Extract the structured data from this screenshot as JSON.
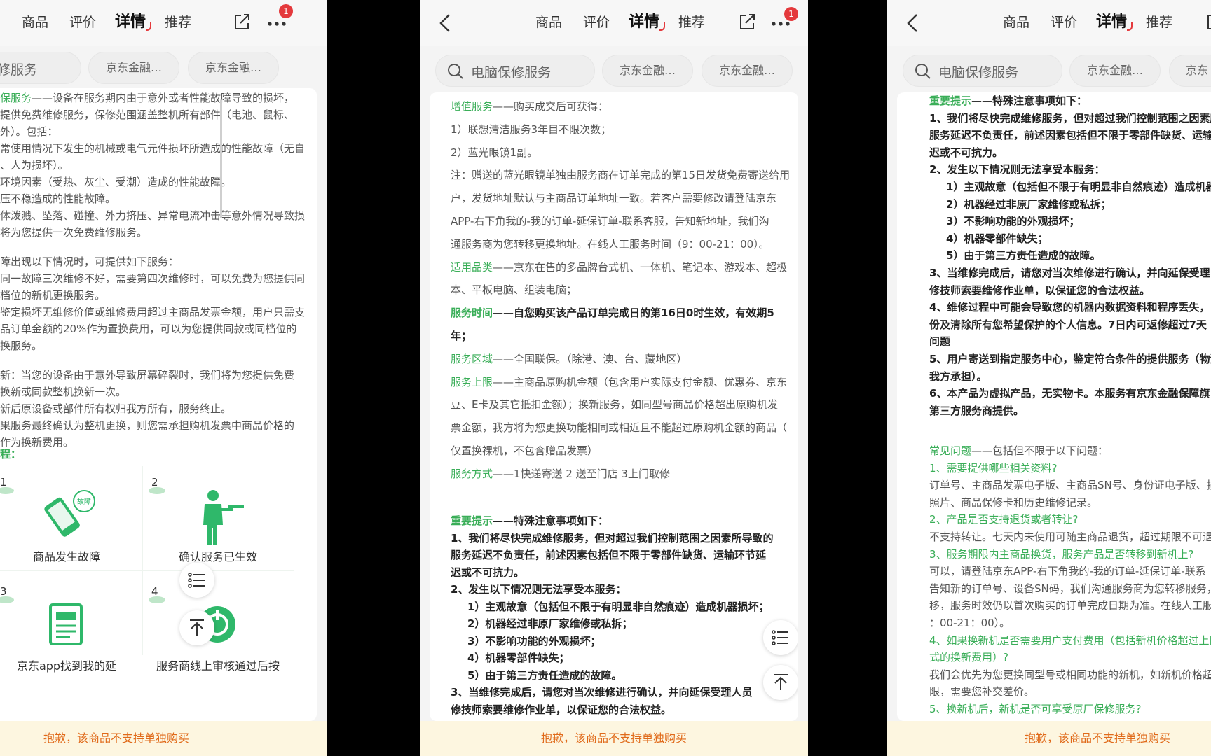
{
  "header": {
    "tabs": [
      "商品",
      "评价",
      "详情",
      "推荐"
    ],
    "active_tab": "详情",
    "badge_count": "1"
  },
  "chips": {
    "search_label": "电脑保修服务",
    "chip1": "京东金融…",
    "chip2": "京东金融…",
    "chip3": "京东"
  },
  "bottom_notice": "抱歉，该商品不支持单独购买",
  "panel1": {
    "lines": [
      {
        "h": "保服务",
        "t": "——设备在服务期内由于意外或者性能故障导致的损坏，"
      },
      {
        "t": "提供免费维修服务，保修范围涵盖整机所有部件（电池、鼠标、"
      },
      {
        "t": "外）。包括："
      },
      {
        "t": "常使用情况下发生的机械或电气元件损坏所造成的性能故障（无自"
      },
      {
        "t": "、人为损坏）。"
      },
      {
        "t": "环境因素（受热、灰尘、受潮）造成的性能故障。"
      },
      {
        "t": "压不稳造成的性能故障。"
      },
      {
        "t": "体泼溅、坠落、碰撞、外力挤压、异常电流冲击等意外情况导致损"
      },
      {
        "t": "将为您提供一次免费维修服务。"
      },
      {
        "gap": true
      },
      {
        "t": "障出现以下情况时，可提供如下服务："
      },
      {
        "t": "同一故障三次维修不好，需要第四次维修时，可以免费为您提供同"
      },
      {
        "t": "档位的新机更换服务。"
      },
      {
        "t": "鉴定损坏无维修价值或维修费用超过主商品发票金额，用户只需支"
      },
      {
        "t": "品订单金额的20%作为置换费用，可以为您提供同款或同档位的"
      },
      {
        "t": "换服务。"
      },
      {
        "gap": true
      },
      {
        "t": "新：当您的设备由于意外导致屏幕碎裂时，我们将为您提供免费"
      },
      {
        "t": "换新或同款整机换新一次。"
      },
      {
        "t": "新后原设备或部件所有权归我方所有，服务终止。"
      },
      {
        "t": "果服务最终确认为整机更换，则您需承担购机发票中商品价格的"
      },
      {
        "t": "作为换新费用。"
      }
    ],
    "flow_title": "程：",
    "steps": [
      {
        "num": "1",
        "label": "商品发生故障",
        "tag": "故障"
      },
      {
        "num": "2",
        "label": "确认服务已生效"
      },
      {
        "num": "3",
        "label": "京东app找到我的延"
      },
      {
        "num": "4",
        "label": "服务商线上审核通过后按"
      }
    ]
  },
  "panel2": {
    "lines": [
      {
        "h": "增值服务",
        "t": "——购买成交后可获得："
      },
      {
        "t": "1）联想清洁服务3年目不限次数；"
      },
      {
        "t": "2）蓝光眼镜1副。"
      },
      {
        "t": "注：赠送的蓝光眼镜单独由服务商在订单完成的第15日发货免费寄送给用"
      },
      {
        "t": "户，发货地址默认与主商品订单地址一致。若客户需要修改请登陆京东"
      },
      {
        "t": "APP-右下角我的-我的订单-延保订单-联系客服，告知新地址，我们沟"
      },
      {
        "t": "通服务商为您转移更换地址。在线人工服务时间（9：00-21：00）。"
      },
      {
        "h": "适用品类",
        "t": "——京东在售的多品牌台式机、一体机、笔记本、游戏本、超极"
      },
      {
        "t": "本、平板电脑、组装电脑；"
      },
      {
        "hb": "服务时间",
        "b": "——自您购买该产品订单完成日的第16日0时生效，有效期5"
      },
      {
        "b": "年；"
      },
      {
        "h": "服务区域",
        "t": "——全国联保。（除港、澳、台、藏地区）"
      },
      {
        "h": "服务上限",
        "t": "——主商品原购机金额（包含用户实际支付金额、优惠券、京东"
      },
      {
        "t": "豆、E卡及其它抵扣金额）；换新服务，如同型号商品价格超出原购机发"
      },
      {
        "t": "票金额，我方将为您更换功能相同或相近且不能超过原购机金额的商品（"
      },
      {
        "t": "仅置换裸机，不包含赠品发票）"
      },
      {
        "h": "服务方式",
        "t": "——1快递寄送 2 送至门店 3上门取修"
      }
    ],
    "notice_head": "重要提示",
    "notice_sub": "——特殊注意事项如下：",
    "notice_lines": [
      {
        "b": "1、我们将尽快完成维修服务，但对超过我们控制范围之因素所导致的"
      },
      {
        "b": "服务延迟不负责任，前述因素包括但不限于零部件缺货、运输环节延"
      },
      {
        "b": "迟或不可抗力。"
      },
      {
        "b": "2、发生以下情况则无法享受本服务："
      },
      {
        "b": "1）主观故意（包括但不限于有明显非自然痕迹）造成机器损坏；",
        "ind": true
      },
      {
        "b": "2）机器经过非原厂家维修或私拆；",
        "ind": true
      },
      {
        "b": "3）不影响功能的外观损坏；",
        "ind": true
      },
      {
        "b": "4）机器零部件缺失；",
        "ind": true
      },
      {
        "b": "5）由于第三方责任造成的故障。",
        "ind": true
      },
      {
        "b": "3、当维修完成后，请您对当次维修进行确认，并向延保受理人员"
      },
      {
        "b": "修技师索要维修作业单，以保证您的合法权益。"
      }
    ]
  },
  "panel3": {
    "notice_head": "重要提示",
    "notice_sub": "——特殊注意事项如下：",
    "notice_lines": [
      {
        "b": "1、我们将尽快完成维修服务，但对超过我们控制范围之因素所"
      },
      {
        "b": "服务延迟不负责任，前述因素包括但不限于零部件缺货、运输"
      },
      {
        "b": "迟或不可抗力。"
      },
      {
        "b": "2、发生以下情况则无法享受本服务："
      },
      {
        "b": "1）主观故意（包括但不限于有明显非自然痕迹）造成机器",
        "ind": true
      },
      {
        "b": "2）机器经过非原厂家维修或私拆；",
        "ind": true
      },
      {
        "b": "3）不影响功能的外观损坏；",
        "ind": true
      },
      {
        "b": "4）机器零部件缺失；",
        "ind": true
      },
      {
        "b": "5）由于第三方责任造成的故障。",
        "ind": true
      },
      {
        "b": "3、当维修完成后，请您对当次维修进行确认，并向延保受理"
      },
      {
        "b": "修技师索要维修作业单，以保证您的合法权益。"
      },
      {
        "b": "4、维修过程中可能会导致您的机器内数据资料和程序丢失，"
      },
      {
        "b": "份及清除所有您希望保护的个人信息。7日内可返修超过7天"
      },
      {
        "b": "问题"
      },
      {
        "b": "5、用户寄送到指定服务中心，鉴定符合条件的提供服务（物流"
      },
      {
        "b": "我方承担）。"
      },
      {
        "b": "6、本产品为虚拟产品，无实物卡。本服务有京东金融保障旗"
      },
      {
        "b": "第三方服务商提供。"
      }
    ],
    "faq_head": "常见问题",
    "faq_sub": "——包括但不限于以下问题：",
    "faq_lines": [
      {
        "q": "1、需要提供哪些相关资料?"
      },
      {
        "t": "订单号、主商品发票电子版、主商品SN号、身份证电子版、损"
      },
      {
        "t": "照片、商品保修卡和历史维修记录。"
      },
      {
        "q": "2、产品是否支持退货或者转让?"
      },
      {
        "t": "不支持转让。七天内未使用可随主商品退货，超过期限不可退。"
      },
      {
        "q": "3、服务期限内主商品换货，服务产品是否转移到新机上?"
      },
      {
        "t": "可以，请登陆京东APP-右下角我的-我的订单-延保订单-联系"
      },
      {
        "t": "告知新的订单号、设备SN码，我们沟通服务商为您转移服务，"
      },
      {
        "t": "移，服务时效仍以首次购买的订单完成日期为准。在线人工服务"
      },
      {
        "t": "：00-21：00）。"
      },
      {
        "q": "4、如果换新机是否需要用户支付费用（包括新机价格超过上限"
      },
      {
        "q": "式的换新费用）?"
      },
      {
        "t": "我们会优先为您更换同型号或相同功能的新机，如新机价格超过"
      },
      {
        "t": "限，需要您补交差价。"
      },
      {
        "q": "5、换新机后，新机是否可享受原厂保修服务?"
      }
    ]
  }
}
